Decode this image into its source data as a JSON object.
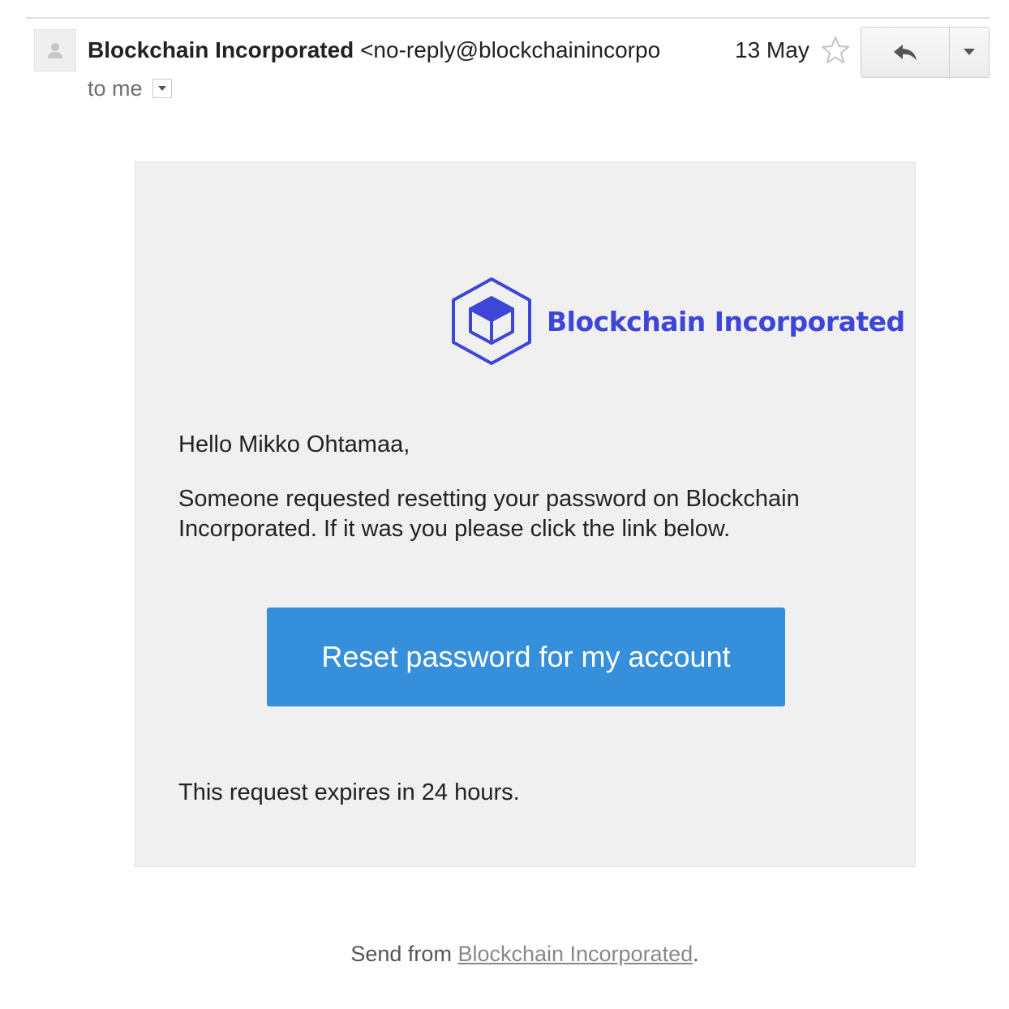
{
  "header": {
    "sender_name": "Blockchain Incorporated",
    "sender_email": "<no-reply@blockchainincorpo",
    "to_label": "to me",
    "date": "13 May"
  },
  "logo": {
    "brand_text": "Blockchain Incorporated",
    "brand_color": "#3d46d6"
  },
  "body": {
    "greeting": "Hello Mikko Ohtamaa,",
    "message": "Someone requested resetting your password on Blockchain Incorporated. If it was you please click the link below.",
    "button_label": "Reset password for my account",
    "button_color": "#368fdb",
    "expiry_note": "This request expires in 24 hours."
  },
  "footer": {
    "prefix": "Send from ",
    "link_text": "Blockchain Incorporated",
    "suffix": "."
  },
  "icons": {
    "avatar": "default-avatar-icon",
    "to_dropdown": "chevron-down-icon",
    "star": "star-icon",
    "reply": "reply-icon",
    "more": "caret-down-icon",
    "logo": "hexagon-cube-icon"
  }
}
